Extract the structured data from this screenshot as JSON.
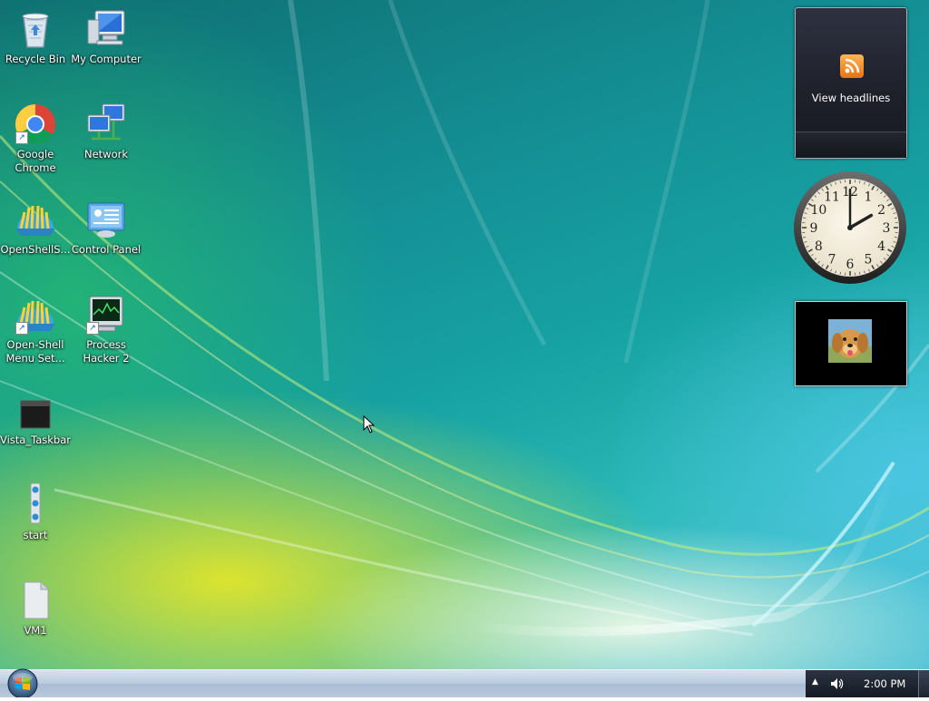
{
  "desktop": {
    "icons": [
      {
        "id": "recycle",
        "label": "Recycle Bin"
      },
      {
        "id": "mycomputer",
        "label": "My Computer"
      },
      {
        "id": "chrome",
        "label": "Google Chrome"
      },
      {
        "id": "network",
        "label": "Network"
      },
      {
        "id": "openshell",
        "label": "OpenShellS..."
      },
      {
        "id": "controlpanel",
        "label": "Control Panel"
      },
      {
        "id": "openshellmenu",
        "label": "Open-Shell Menu Set..."
      },
      {
        "id": "processhacker",
        "label": "Process Hacker 2"
      },
      {
        "id": "vistataskbar",
        "label": "Vista_Taskbar"
      },
      {
        "id": "start",
        "label": "start"
      },
      {
        "id": "vm1",
        "label": "VM1"
      }
    ]
  },
  "gadgets": {
    "feed": {
      "text": "View headlines",
      "icon": "rss-icon"
    },
    "clock": {
      "hours": 2,
      "minutes": 0,
      "numerals": [
        "12",
        "1",
        "2",
        "3",
        "4",
        "5",
        "6",
        "7",
        "8",
        "9",
        "10",
        "11"
      ]
    },
    "slideshow": {
      "icon": "dog-photo"
    }
  },
  "taskbar": {
    "start_icon": "windows-orb-icon",
    "tray": {
      "time": "2:00 PM",
      "icons": [
        "show-hidden-icons-arrow",
        "volume-icon"
      ]
    }
  },
  "colors": {
    "accent": "#1ea4a4",
    "taskbar": "#b9cadd",
    "tray": "#1d2330"
  }
}
